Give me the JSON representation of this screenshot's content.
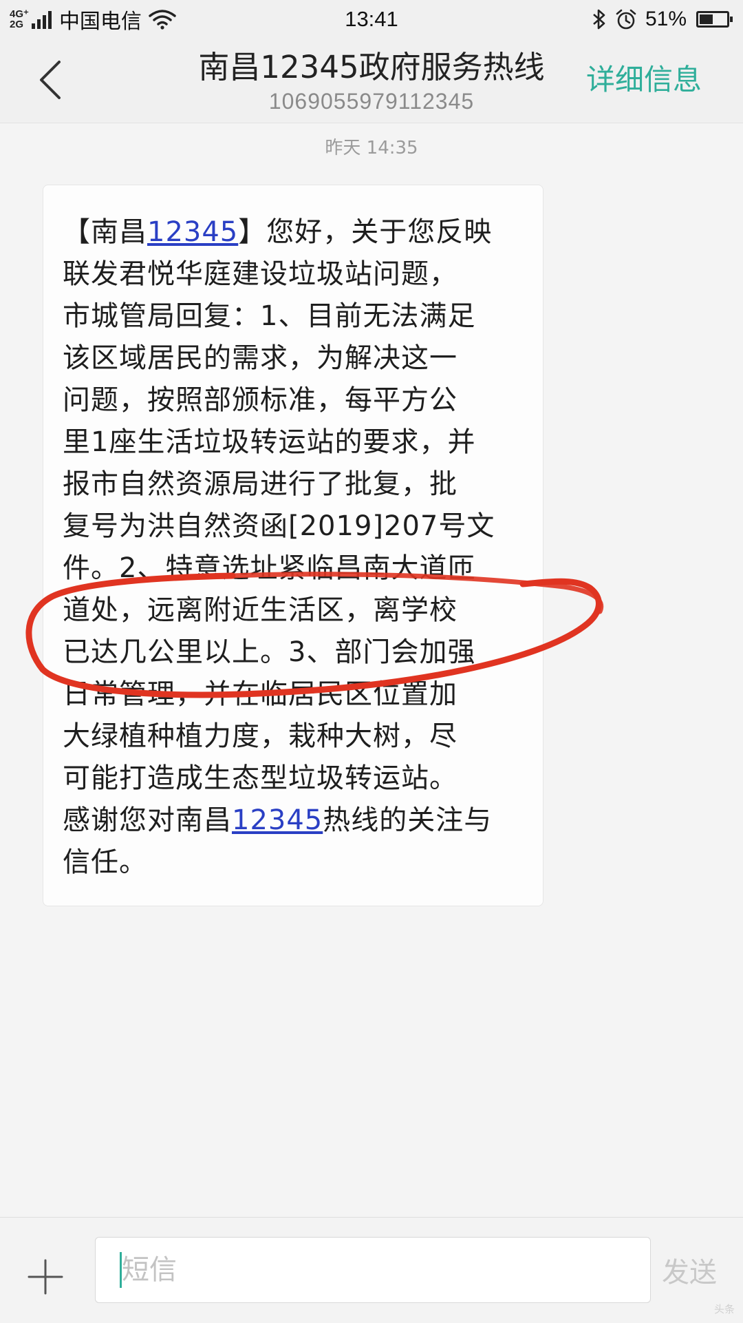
{
  "status_bar": {
    "network_top": "4G⁺",
    "network_bottom": "2G",
    "carrier": "中国电信",
    "time": "13:41",
    "battery_percent": "51%",
    "battery_level": 0.51,
    "icons": [
      "signal-icon",
      "wifi-icon",
      "bluetooth-icon",
      "alarm-icon",
      "battery-icon"
    ]
  },
  "header": {
    "back_icon": "chevron-left-icon",
    "title": "南昌12345政府服务热线",
    "number": "1069055979112345",
    "details_label": "详细信息"
  },
  "conversation": {
    "timestamp": "昨天 14:35",
    "message": {
      "lines": [
        [
          "【南昌",
          {
            "link": "12345"
          },
          "】您好，关于您反映"
        ],
        [
          "联发君悦华庭建设垃圾站问题，"
        ],
        [
          "市城管局回复：1、目前无法满足"
        ],
        [
          "该区域居民的需求，为解决这一"
        ],
        [
          "问题，按照部颁标准，每平方公"
        ],
        [
          "里1座生活垃圾转运站的要求，并"
        ],
        [
          "报市自然资源局进行了批复，批"
        ],
        [
          "复号为洪自然资函[2019]207号文"
        ],
        [
          "件。2、特意选址紧临昌南大道匝"
        ],
        [
          "道处，远离附近生活区，离学校"
        ],
        [
          "已达几公里以上。3、部门会加强"
        ],
        [
          "日常管理，并在临居民区位置加"
        ],
        [
          "大绿植种植力度，栽种大树，尽"
        ],
        [
          "可能打造成生态型垃圾转运站。"
        ],
        [
          "感谢您对南昌",
          {
            "link": "12345"
          },
          "热线的关注与"
        ],
        [
          "信任。"
        ]
      ]
    },
    "annotation": {
      "shape": "hand-drawn ellipse",
      "color": "#e03421"
    }
  },
  "composer": {
    "attach_icon": "plus-icon",
    "input_placeholder": "短信",
    "input_value": "",
    "send_label": "发送"
  },
  "watermark": "头条"
}
